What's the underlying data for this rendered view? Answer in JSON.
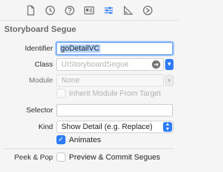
{
  "toolbar": {
    "icons": [
      "file-icon",
      "history-icon",
      "help-icon",
      "identity-icon",
      "attributes-icon",
      "size-icon",
      "connections-icon"
    ],
    "active": "attributes-icon",
    "accent": "#2f7cf6"
  },
  "section": {
    "title": "Storyboard Segue"
  },
  "identifier": {
    "label": "Identifier",
    "value": "goDetailVC"
  },
  "class": {
    "label": "Class",
    "placeholder": "UIStoryboardSegue"
  },
  "module": {
    "label": "Module",
    "placeholder": "None"
  },
  "inherit": {
    "label": "Inherit Module From Target",
    "checked": false
  },
  "selector": {
    "label": "Selector",
    "value": ""
  },
  "kind": {
    "label": "Kind",
    "value": "Show Detail (e.g. Replace)"
  },
  "animates": {
    "label": "Animates",
    "checked": true
  },
  "peek_pop": {
    "label": "Peek & Pop",
    "option_label": "Preview & Commit Segues",
    "checked": false
  }
}
